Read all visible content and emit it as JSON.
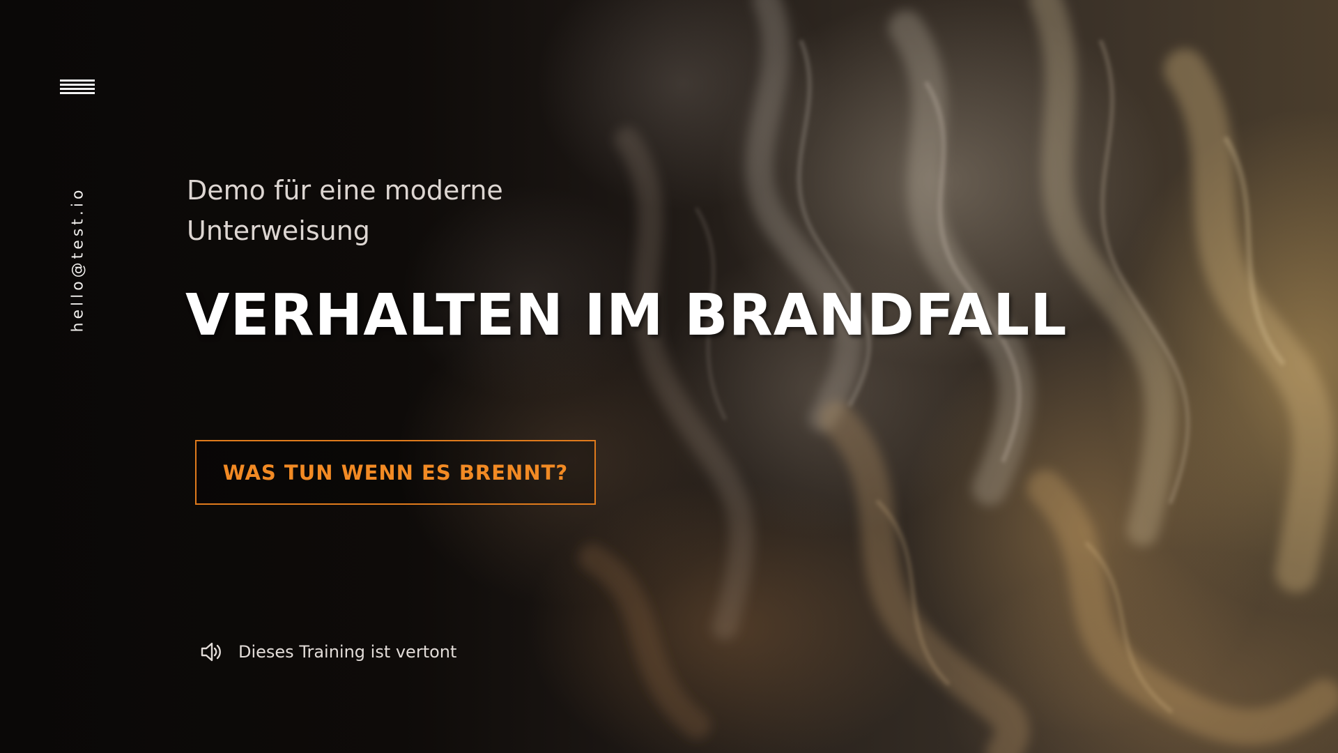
{
  "nav": {
    "menu_icon": "hamburger-menu-icon",
    "email": "hello@test.io"
  },
  "hero": {
    "subtitle": "Demo für eine moderne Unterweisung",
    "title": "VERHALTEN IM BRANDFALL",
    "cta_label": "WAS TUN WENN ES BRENNT?"
  },
  "audio": {
    "icon": "speaker-icon",
    "label": "Dieses Training ist vertont"
  },
  "colors": {
    "accent": "#f28a24",
    "accent_border": "#e07b1c",
    "background": "#0b0908",
    "text": "#ffffff"
  }
}
